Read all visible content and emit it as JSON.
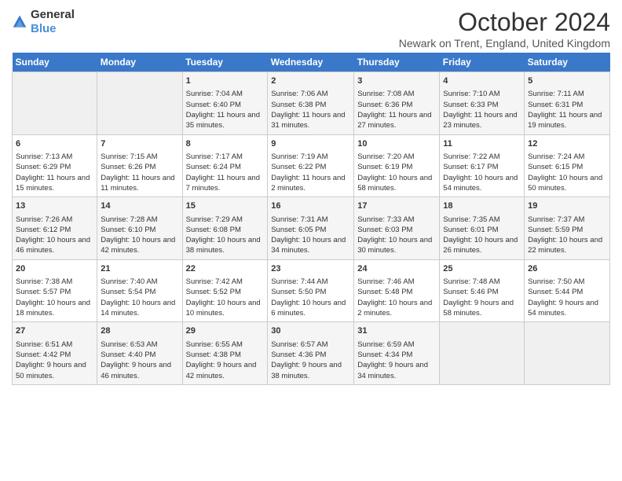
{
  "header": {
    "logo_general": "General",
    "logo_blue": "Blue",
    "month_title": "October 2024",
    "subtitle": "Newark on Trent, England, United Kingdom"
  },
  "days_of_week": [
    "Sunday",
    "Monday",
    "Tuesday",
    "Wednesday",
    "Thursday",
    "Friday",
    "Saturday"
  ],
  "weeks": [
    [
      {
        "day": "",
        "info": ""
      },
      {
        "day": "",
        "info": ""
      },
      {
        "day": "1",
        "info": "Sunrise: 7:04 AM\nSunset: 6:40 PM\nDaylight: 11 hours and 35 minutes."
      },
      {
        "day": "2",
        "info": "Sunrise: 7:06 AM\nSunset: 6:38 PM\nDaylight: 11 hours and 31 minutes."
      },
      {
        "day": "3",
        "info": "Sunrise: 7:08 AM\nSunset: 6:36 PM\nDaylight: 11 hours and 27 minutes."
      },
      {
        "day": "4",
        "info": "Sunrise: 7:10 AM\nSunset: 6:33 PM\nDaylight: 11 hours and 23 minutes."
      },
      {
        "day": "5",
        "info": "Sunrise: 7:11 AM\nSunset: 6:31 PM\nDaylight: 11 hours and 19 minutes."
      }
    ],
    [
      {
        "day": "6",
        "info": "Sunrise: 7:13 AM\nSunset: 6:29 PM\nDaylight: 11 hours and 15 minutes."
      },
      {
        "day": "7",
        "info": "Sunrise: 7:15 AM\nSunset: 6:26 PM\nDaylight: 11 hours and 11 minutes."
      },
      {
        "day": "8",
        "info": "Sunrise: 7:17 AM\nSunset: 6:24 PM\nDaylight: 11 hours and 7 minutes."
      },
      {
        "day": "9",
        "info": "Sunrise: 7:19 AM\nSunset: 6:22 PM\nDaylight: 11 hours and 2 minutes."
      },
      {
        "day": "10",
        "info": "Sunrise: 7:20 AM\nSunset: 6:19 PM\nDaylight: 10 hours and 58 minutes."
      },
      {
        "day": "11",
        "info": "Sunrise: 7:22 AM\nSunset: 6:17 PM\nDaylight: 10 hours and 54 minutes."
      },
      {
        "day": "12",
        "info": "Sunrise: 7:24 AM\nSunset: 6:15 PM\nDaylight: 10 hours and 50 minutes."
      }
    ],
    [
      {
        "day": "13",
        "info": "Sunrise: 7:26 AM\nSunset: 6:12 PM\nDaylight: 10 hours and 46 minutes."
      },
      {
        "day": "14",
        "info": "Sunrise: 7:28 AM\nSunset: 6:10 PM\nDaylight: 10 hours and 42 minutes."
      },
      {
        "day": "15",
        "info": "Sunrise: 7:29 AM\nSunset: 6:08 PM\nDaylight: 10 hours and 38 minutes."
      },
      {
        "day": "16",
        "info": "Sunrise: 7:31 AM\nSunset: 6:05 PM\nDaylight: 10 hours and 34 minutes."
      },
      {
        "day": "17",
        "info": "Sunrise: 7:33 AM\nSunset: 6:03 PM\nDaylight: 10 hours and 30 minutes."
      },
      {
        "day": "18",
        "info": "Sunrise: 7:35 AM\nSunset: 6:01 PM\nDaylight: 10 hours and 26 minutes."
      },
      {
        "day": "19",
        "info": "Sunrise: 7:37 AM\nSunset: 5:59 PM\nDaylight: 10 hours and 22 minutes."
      }
    ],
    [
      {
        "day": "20",
        "info": "Sunrise: 7:38 AM\nSunset: 5:57 PM\nDaylight: 10 hours and 18 minutes."
      },
      {
        "day": "21",
        "info": "Sunrise: 7:40 AM\nSunset: 5:54 PM\nDaylight: 10 hours and 14 minutes."
      },
      {
        "day": "22",
        "info": "Sunrise: 7:42 AM\nSunset: 5:52 PM\nDaylight: 10 hours and 10 minutes."
      },
      {
        "day": "23",
        "info": "Sunrise: 7:44 AM\nSunset: 5:50 PM\nDaylight: 10 hours and 6 minutes."
      },
      {
        "day": "24",
        "info": "Sunrise: 7:46 AM\nSunset: 5:48 PM\nDaylight: 10 hours and 2 minutes."
      },
      {
        "day": "25",
        "info": "Sunrise: 7:48 AM\nSunset: 5:46 PM\nDaylight: 9 hours and 58 minutes."
      },
      {
        "day": "26",
        "info": "Sunrise: 7:50 AM\nSunset: 5:44 PM\nDaylight: 9 hours and 54 minutes."
      }
    ],
    [
      {
        "day": "27",
        "info": "Sunrise: 6:51 AM\nSunset: 4:42 PM\nDaylight: 9 hours and 50 minutes."
      },
      {
        "day": "28",
        "info": "Sunrise: 6:53 AM\nSunset: 4:40 PM\nDaylight: 9 hours and 46 minutes."
      },
      {
        "day": "29",
        "info": "Sunrise: 6:55 AM\nSunset: 4:38 PM\nDaylight: 9 hours and 42 minutes."
      },
      {
        "day": "30",
        "info": "Sunrise: 6:57 AM\nSunset: 4:36 PM\nDaylight: 9 hours and 38 minutes."
      },
      {
        "day": "31",
        "info": "Sunrise: 6:59 AM\nSunset: 4:34 PM\nDaylight: 9 hours and 34 minutes."
      },
      {
        "day": "",
        "info": ""
      },
      {
        "day": "",
        "info": ""
      }
    ]
  ]
}
